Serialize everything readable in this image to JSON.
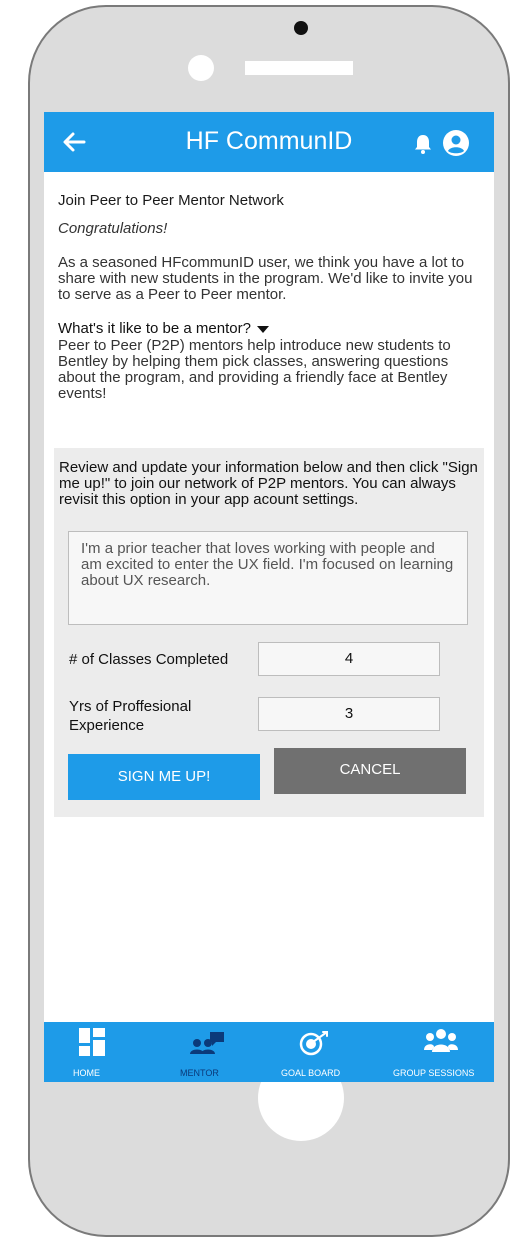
{
  "app": {
    "title": "HF CommunID"
  },
  "intro": {
    "heading": "Join Peer to Peer Mentor Network",
    "congrats": "Congratulations!",
    "paragraph": "As a seasoned HFcommunID user, we think you have a lot to share with new students in the program. We'd like to invite you to serve as a Peer to Peer mentor."
  },
  "mentor_info": {
    "question": "What's it like to be a mentor?",
    "description": "Peer to Peer (P2P) mentors help introduce new students to Bentley by helping them pick classes, answering questions about the program, and providing a friendly face at Bentley events!"
  },
  "form": {
    "instructions": "Review and update your information below and then click \"Sign me up!\" to join our network of P2P mentors. You can always revisit this option in your app acount settings.",
    "bio": "I'm a prior teacher that loves working with people and am excited to enter the UX field. I'm focused on learning about UX research.",
    "classes_label": "# of Classes Completed",
    "classes_value": "4",
    "experience_label": "Yrs of Proffesional Experience",
    "experience_value": "3",
    "sign_up_label": "SIGN ME UP!",
    "cancel_label": "CANCEL"
  },
  "tabs": [
    {
      "label": "HOME",
      "icon": "home-icon",
      "active": false
    },
    {
      "label": "MENTOR",
      "icon": "mentor-icon",
      "active": true
    },
    {
      "label": "GOAL BOARD",
      "icon": "goal-board-icon",
      "active": false
    },
    {
      "label": "GROUP SESSIONS",
      "icon": "group-sessions-icon",
      "active": false
    }
  ],
  "colors": {
    "primary": "#1e9be8",
    "active_tab": "#0b3a7a",
    "cancel": "#707070",
    "panel": "#ececec"
  }
}
